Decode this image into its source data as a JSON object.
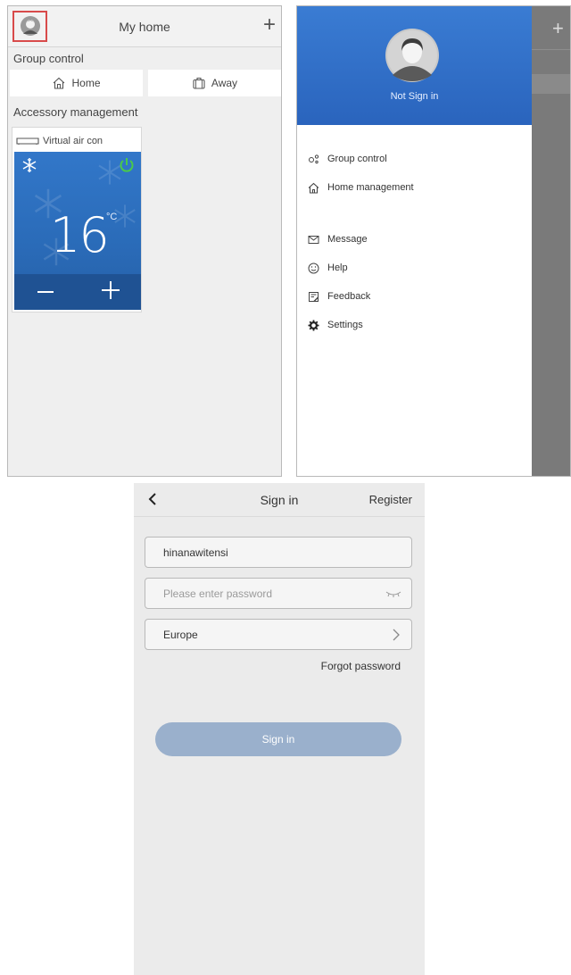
{
  "home": {
    "title": "My home",
    "add_label": "+",
    "group_control_label": "Group control",
    "home_button_label": "Home",
    "away_button_label": "Away",
    "accessory_label": "Accessory management",
    "device": {
      "name": "Virtual air con",
      "temperature": "16",
      "unit": "°C",
      "mode_icon": "snowflake-icon",
      "power_on": true,
      "power_color": "#4ac94a"
    }
  },
  "drawer": {
    "not_signed_in": "Not Sign in",
    "menu": [
      {
        "label": "Group control",
        "icon": "group-control-icon"
      },
      {
        "label": "Home management",
        "icon": "home-icon"
      },
      {
        "label": "Message",
        "icon": "message-icon"
      },
      {
        "label": "Help",
        "icon": "help-icon"
      },
      {
        "label": "Feedback",
        "icon": "feedback-icon"
      },
      {
        "label": "Settings",
        "icon": "settings-icon"
      }
    ],
    "background_add_label": "+",
    "header_color": "#2f6fcb"
  },
  "signin": {
    "title": "Sign in",
    "register_label": "Register",
    "username_value": "hinanawitensi",
    "password_placeholder": "Please enter password",
    "region_value": "Europe",
    "forgot_label": "Forgot password",
    "signin_button_label": "Sign in",
    "button_color": "#9ab0cc"
  }
}
